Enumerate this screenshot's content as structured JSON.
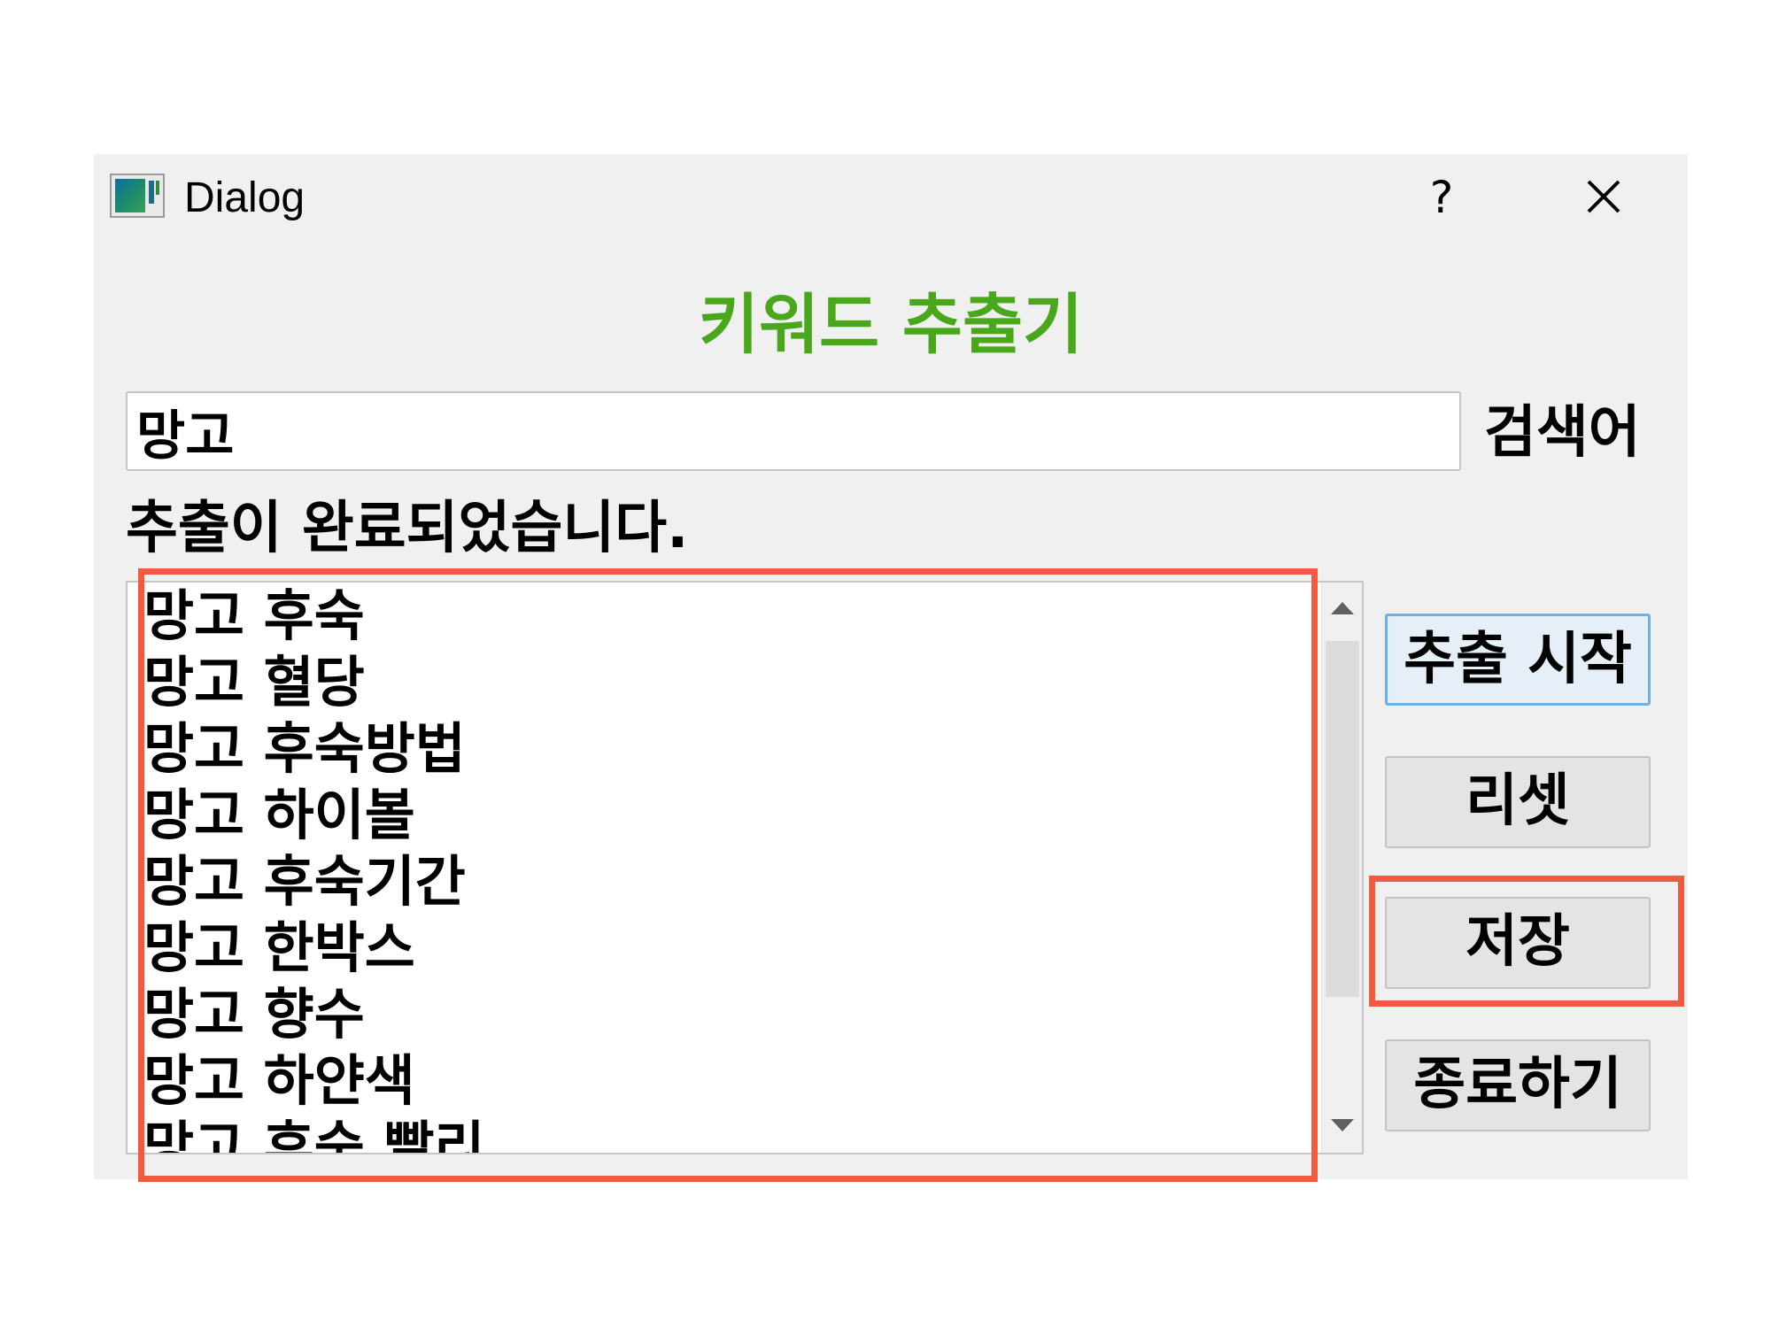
{
  "window": {
    "title": "Dialog",
    "help_label": "?",
    "close_icon": "close-icon"
  },
  "heading": "키워드 추출기",
  "heading_color": "#4aa61b",
  "search": {
    "value": "망고",
    "label": "검색어"
  },
  "status": "추출이 완료되었습니다.",
  "results": [
    "망고 후숙",
    "망고 혈당",
    "망고 후숙방법",
    "망고 하이볼",
    "망고 후숙기간",
    "망고 한박스",
    "망고 향수",
    "망고 하얀색",
    "망고 후숙 빨리"
  ],
  "buttons": {
    "start": "추출 시작",
    "reset": "리셋",
    "save": "저장",
    "quit": "종료하기"
  },
  "highlight_color": "#f15a3e"
}
